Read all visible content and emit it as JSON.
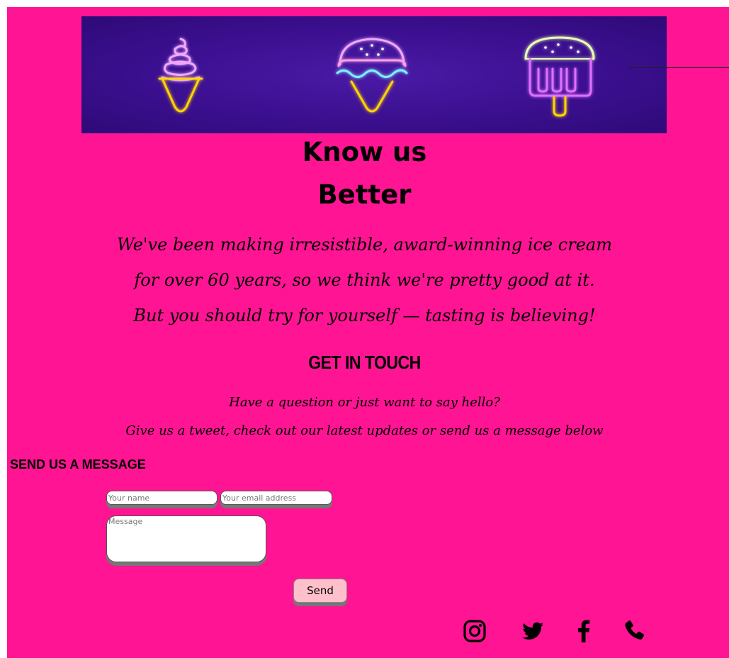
{
  "banner": {
    "background": "#3b0f8f",
    "icons": [
      "soft-serve-cone-icon",
      "scoop-cone-icon",
      "popsicle-icon"
    ]
  },
  "heading": {
    "line1": "Know us",
    "line2": "Better"
  },
  "intro": {
    "line1": "We've been making irresistible, award-winning ice cream",
    "line2": "for over 60 years, so we think we're pretty good at it.",
    "line3": "But you should try for yourself — tasting is believing!"
  },
  "contact": {
    "title": "GET IN TOUCH",
    "sub1": "Have a question or just want to say hello?",
    "sub2": "Give us a tweet, check out our latest updates or send us a message below"
  },
  "form": {
    "heading": "SEND US A MESSAGE",
    "name_placeholder": "Your name",
    "email_placeholder": "Your email address",
    "message_placeholder": "Message",
    "send_label": "Send"
  },
  "social": [
    "instagram-icon",
    "twitter-icon",
    "facebook-icon",
    "phone-icon"
  ],
  "colors": {
    "page_bg": "#ff1493",
    "button_bg": "#ffc0cb",
    "text": "#000000"
  }
}
